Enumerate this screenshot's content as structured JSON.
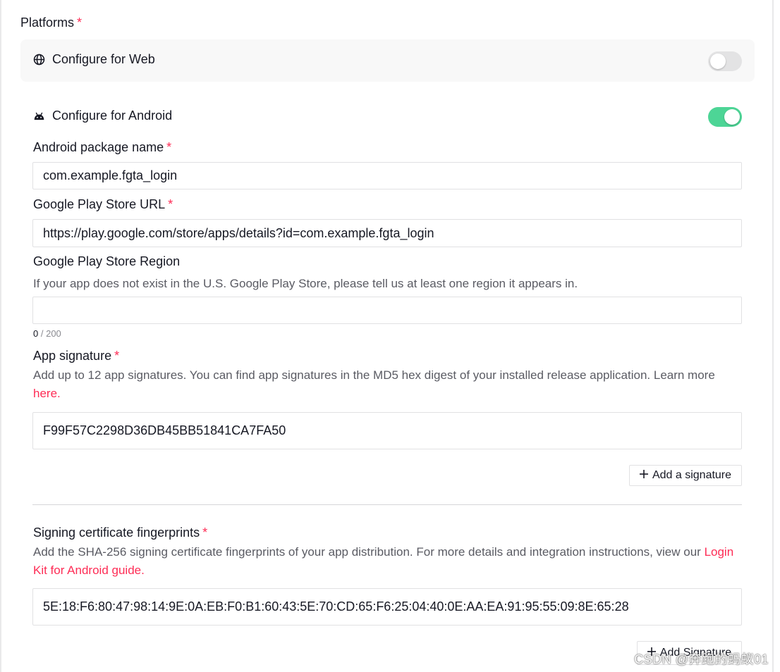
{
  "platforms": {
    "title": "Platforms",
    "required_mark": "*"
  },
  "web": {
    "label": "Configure for Web",
    "icon": "globe-icon",
    "enabled": false
  },
  "android": {
    "label": "Configure for Android",
    "icon": "android-icon",
    "enabled": true,
    "toggle_color": "#4dd596"
  },
  "package_name": {
    "label": "Android package name",
    "required_mark": "*",
    "value": "com.example.fgta_login"
  },
  "play_store_url": {
    "label": "Google Play Store URL",
    "required_mark": "*",
    "value": "https://play.google.com/store/apps/details?id=com.example.fgta_login"
  },
  "play_store_region": {
    "label": "Google Play Store Region",
    "help": "If your app does not exist in the U.S. Google Play Store, please tell us at least one region it appears in.",
    "value": "",
    "count_current": "0",
    "count_max": "/ 200"
  },
  "app_signature": {
    "label": "App signature",
    "required_mark": "*",
    "help": "Add up to 12 app signatures. You can find app signatures in the MD5 hex digest of your installed release application. Learn more",
    "help_link": "here.",
    "value": "F99F57C2298D36DB45BB51841CA7FA50",
    "add_button_label": "Add a signature"
  },
  "fingerprints": {
    "label": "Signing certificate fingerprints",
    "required_mark": "*",
    "help": "Add the SHA-256 signing certificate fingerprints of your app distribution. For more details and integration instructions, view our",
    "help_link": "Login Kit for Android guide.",
    "value": "5E:18:F6:80:47:98:14:9E:0A:EB:F0:B1:60:43:5E:70:CD:65:F6:25:04:40:0E:AA:EA:91:95:55:09:8E:65:28",
    "add_button_label": "Add Signature"
  },
  "watermark": "CSDN @奔跑的蚂蚁01",
  "colors": {
    "accent": "#fe2c55",
    "toggle_on": "#4dd596",
    "toggle_off": "#e3e3e4"
  }
}
